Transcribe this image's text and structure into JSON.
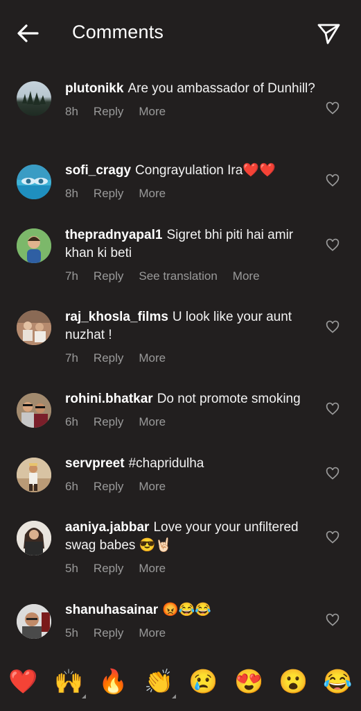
{
  "header": {
    "title": "Comments",
    "back_icon": "arrow-left-icon",
    "send_icon": "paper-plane-icon"
  },
  "comments": [
    {
      "username": "plutonikk",
      "text": "Are you ambassador of Dunhill?",
      "time": "8h",
      "reply": "Reply",
      "more": "More"
    },
    {
      "username": "sofi_cragy",
      "text": "Congrayulation Ira❤️❤️",
      "time": "8h",
      "reply": "Reply",
      "more": "More"
    },
    {
      "username": "thepradnyapal1",
      "text": "Sigret bhi piti hai amir khan ki beti",
      "time": "7h",
      "reply": "Reply",
      "translate": "See translation",
      "more": "More"
    },
    {
      "username": "raj_khosla_films",
      "text": "U look like your aunt nuzhat !",
      "time": "7h",
      "reply": "Reply",
      "more": "More"
    },
    {
      "username": "rohini.bhatkar",
      "text": "Do not promote smoking",
      "time": "6h",
      "reply": "Reply",
      "more": "More"
    },
    {
      "username": "servpreet",
      "text": "#chapridulha",
      "time": "6h",
      "reply": "Reply",
      "more": "More"
    },
    {
      "username": "aaniya.jabbar",
      "text": "Love your your unfiltered swag babes 😎🤘🏻",
      "time": "5h",
      "reply": "Reply",
      "more": "More"
    },
    {
      "username": "shanuhasainar",
      "text": "😡😂😂",
      "time": "5h",
      "reply": "Reply",
      "more": "More"
    }
  ],
  "emoji_bar": [
    "❤️",
    "🙌",
    "🔥",
    "👏",
    "😢",
    "😍",
    "😮",
    "😂"
  ],
  "colors": {
    "background": "#221f1f",
    "text": "#ffffff",
    "meta": "#9a9a9a"
  }
}
